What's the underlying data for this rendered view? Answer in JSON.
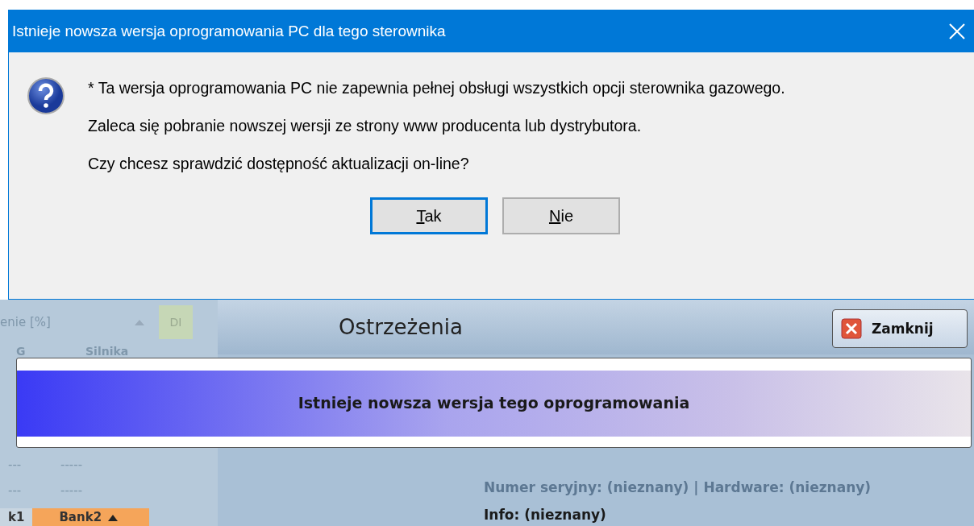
{
  "dialog": {
    "title": "Istnieje nowsza wersja oprogramowania PC dla tego sterownika",
    "messages": [
      "* Ta wersja oprogramowania PC nie zapewnia pełnej obsługi wszystkich opcji sterownika gazowego.",
      "Zaleca się pobranie nowszej wersji ze strony www producenta lub dystrybutora.",
      "Czy chcesz sprawdzić dostępność aktualizacji on-line?"
    ],
    "buttons": [
      {
        "label": "Tak",
        "access_key_underlined": true,
        "default": true
      },
      {
        "label": "Nie",
        "access_key_underlined": true,
        "default": false
      }
    ]
  },
  "background": {
    "left_panel": {
      "header": "enie [%]",
      "columns": [
        "G",
        "Silnika"
      ],
      "di_label": "DI",
      "rows": [
        [
          "---",
          "-----"
        ],
        [
          "---",
          "-----"
        ]
      ],
      "tabs": [
        {
          "label": "k1",
          "selected": false
        },
        {
          "label": "Bank2",
          "selected": true
        }
      ]
    },
    "warnings": {
      "title": "Ostrzeżenia",
      "close_button": "Zamknij",
      "banner": "Istnieje nowsza wersja tego oprogramowania",
      "info_lines": [
        {
          "text": "Numer seryjny: (nieznany) | Hardware: (nieznany)",
          "dimmed": true
        },
        {
          "text": "Info: (nieznany)",
          "dimmed": false
        }
      ]
    }
  }
}
